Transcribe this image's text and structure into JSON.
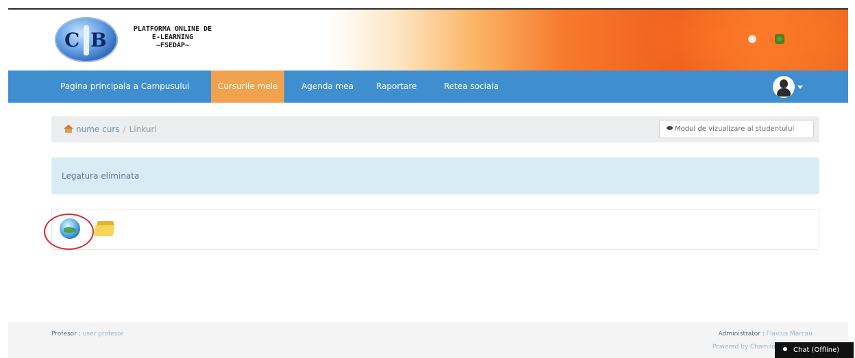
{
  "header": {
    "logo_left": "C",
    "logo_right": "B",
    "title_lines": [
      "PLATFORMA ONLINE DE",
      "E-LEARNING",
      "~FSEDAP~"
    ]
  },
  "nav": {
    "items": [
      {
        "label": "Pagina principala a Campusului"
      },
      {
        "label": "Cursurile mele"
      },
      {
        "label": "Agenda mea"
      },
      {
        "label": "Raportare"
      },
      {
        "label": "Retea sociala"
      }
    ],
    "active_index": 1
  },
  "breadcrumb": {
    "course": "nume curs",
    "separator": "/",
    "current": "Linkuri",
    "student_view_button": "Modul de vizualizare al studentului"
  },
  "alert": {
    "text": "Legatura eliminata"
  },
  "toolbar": {
    "icons": [
      "globe-icon",
      "folder-icon"
    ]
  },
  "footer": {
    "professor_label": "Profesor :",
    "professor_name": "user profesor",
    "admin_label": "Administrator :",
    "admin_name": "Flavius Marcau",
    "powered_by": "Powered by Chamilo"
  },
  "chat": {
    "label": "Chat (Offline)"
  },
  "colors": {
    "nav_bg": "#3f8ed0",
    "nav_active": "#f0a24f",
    "alert_bg": "#d8ecf6",
    "highlight": "#d52b38"
  }
}
